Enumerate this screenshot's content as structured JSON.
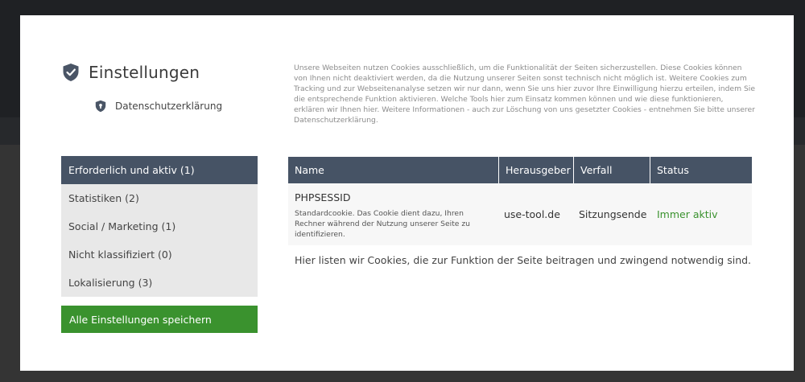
{
  "header": {
    "title": "Einstellungen",
    "privacy_link": "Datenschutzerklärung",
    "shield_icon": "shield-check-icon",
    "privacy_icon": "shield-lock-icon"
  },
  "intro_text": "Unsere Webseiten nutzen Cookies ausschließlich, um die Funktionalität der Seiten sicherzustellen. Diese Cookies können von Ihnen nicht deaktiviert werden, da die Nutzung unserer Seiten sonst technisch nicht möglich ist. Weitere Cookies zum Tracking und zur Webseitenanalyse setzen wir nur dann, wenn Sie uns hier zuvor Ihre Einwilligung hierzu erteilen, indem Sie die entsprechende Funktion aktivieren. Welche Tools hier zum Einsatz kommen können und wie diese funktionieren, erklären wir Ihnen hier. Weitere Informationen - auch zur Löschung von uns gesetzter Cookies - entnehmen Sie bitte unserer Datenschutzerklärung.",
  "categories": [
    {
      "label": "Erforderlich und aktiv (1)",
      "active": true
    },
    {
      "label": "Statistiken (2)",
      "active": false
    },
    {
      "label": "Social / Marketing (1)",
      "active": false
    },
    {
      "label": "Nicht klassifiziert (0)",
      "active": false
    },
    {
      "label": "Lokalisierung (3)",
      "active": false
    }
  ],
  "save_button": "Alle Einstellungen speichern",
  "table": {
    "headers": [
      "Name",
      "Herausgeber",
      "Verfall",
      "Status"
    ],
    "rows": [
      {
        "name": "PHPSESSID",
        "description": "Standardcookie. Das Cookie dient dazu, Ihren Rechner während der Nutzung unserer Seite zu identifizieren.",
        "publisher": "use-tool.de",
        "expiry": "Sitzungsende",
        "status": "Immer aktiv"
      }
    ]
  },
  "footer_note": "Hier listen wir Cookies, die zur Funktion der Seite beitragen und zwingend notwendig sind.",
  "colors": {
    "header_bg": "#465365",
    "accent_green": "#3a922e",
    "inactive_bg": "#e8e8e8"
  }
}
